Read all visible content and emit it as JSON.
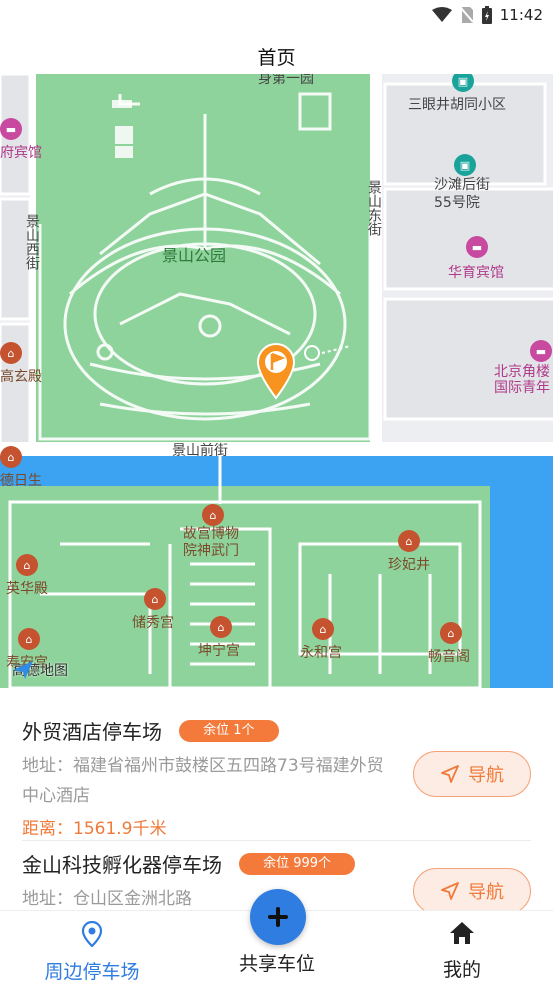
{
  "status_bar": {
    "time": "11:42",
    "icons": [
      "wifi-icon",
      "no-sim-icon",
      "battery-charging-icon"
    ]
  },
  "header": {
    "title": "首页"
  },
  "map": {
    "labels": {
      "park": "景山公园",
      "road_front": "景山前街",
      "road_east": "景山东街",
      "road_west": "景山西街",
      "top_road": "身第一园",
      "sanyanjing": "三眼井胡同小区",
      "shatan": "沙滩后街\n55号院",
      "huayu": "华育宾馆",
      "fu_bingguan": "府宾馆",
      "beijing_jiaolou": "北京角楼\n国际青年",
      "gao_xuan": "高玄殿",
      "de_ri": "德日生",
      "palace_museum": "故宫博物\n院神武门",
      "zhenfei": "珍妃井",
      "yinghua": "英华殿",
      "chuxiu": "储秀宫",
      "kunning": "坤宁宫",
      "yonghe": "永和宫",
      "changyin": "畅音阁",
      "shou_an": "寿安宫"
    },
    "logo_text": "高德地图",
    "colors": {
      "park": "#8fd39c",
      "water": "#3ba3f2",
      "road": "#ffffff",
      "land": "#eceef1",
      "marker": "#f7931e"
    }
  },
  "parking_list": [
    {
      "name": "外贸酒店停车场",
      "badge": "余位 1个",
      "address": "地址：福建省福州市鼓楼区五四路73号福建外贸中心酒店",
      "distance": "距离：1561.9千米",
      "nav_label": "导航"
    },
    {
      "name": "金山科技孵化器停车场",
      "badge": "余位 999个",
      "address": "地址：仓山区金洲北路",
      "nav_label": "导航"
    }
  ],
  "tabs": [
    {
      "label": "周边停车场",
      "icon": "location-pin-icon",
      "active": true,
      "color": "#2f7de1"
    },
    {
      "label": "共享车位",
      "icon": "plus-icon",
      "active": false
    },
    {
      "label": "我的",
      "icon": "home-icon",
      "active": false
    }
  ],
  "accent_color": "#f07a3a"
}
